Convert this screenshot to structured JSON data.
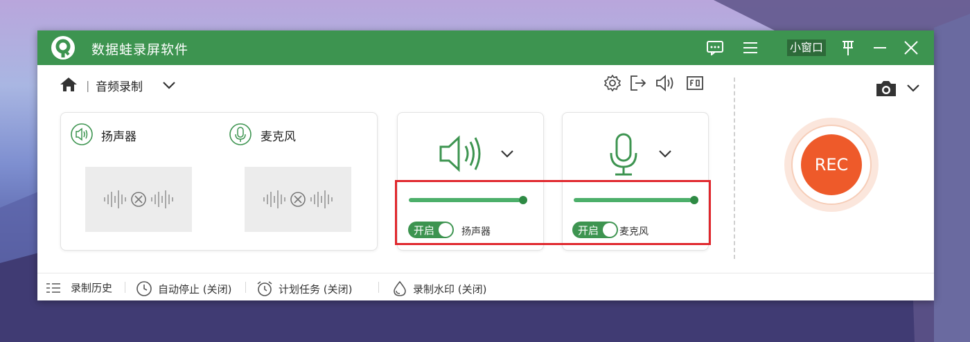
{
  "app": {
    "title": "数据蛙录屏软件",
    "mini_window_label": "小窗口"
  },
  "toolbar": {
    "mode_label": "音频录制"
  },
  "sources": [
    {
      "label": "扬声器"
    },
    {
      "label": "麦克风"
    }
  ],
  "speaker_panel": {
    "volume_fraction": 0.97,
    "toggle_label": "开启",
    "name": "扬声器"
  },
  "mic_panel": {
    "volume_fraction": 1.0,
    "toggle_label": "开启",
    "name": "麦克风"
  },
  "rec": {
    "label": "REC"
  },
  "bottom": {
    "history": "录制历史",
    "auto_stop": "自动停止 (关闭)",
    "schedule": "计划任务 (关闭)",
    "watermark": "录制水印 (关闭)"
  },
  "colors": {
    "brand": "#3d9450",
    "rec": "#ee5a2a",
    "highlight": "#e0262c"
  },
  "icons": [
    "logo",
    "feedback-icon",
    "menu-icon",
    "pin-icon",
    "minimize-icon",
    "close-icon",
    "home-icon",
    "chevron-down-icon",
    "settings-icon",
    "export-icon",
    "speaker-icon",
    "fullscreen-icon",
    "camera-icon",
    "mic-icon",
    "history-icon",
    "clock-icon",
    "alarm-icon",
    "watermark-icon"
  ]
}
